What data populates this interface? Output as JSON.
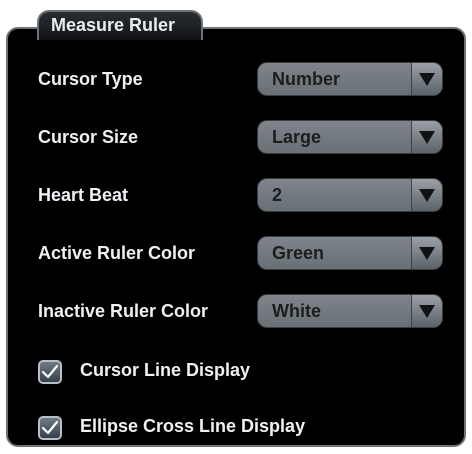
{
  "panel": {
    "title": "Measure Ruler"
  },
  "fields": [
    {
      "label": "Cursor Type",
      "value": "Number"
    },
    {
      "label": "Cursor Size",
      "value": "Large"
    },
    {
      "label": "Heart Beat",
      "value": "2"
    },
    {
      "label": "Active Ruler Color",
      "value": "Green"
    },
    {
      "label": "Inactive Ruler Color",
      "value": "White"
    }
  ],
  "checkboxes": [
    {
      "label": "Cursor Line Display",
      "checked": true
    },
    {
      "label": "Ellipse Cross Line Display",
      "checked": true
    }
  ],
  "icons": {
    "dropdown": "chevron-down-icon",
    "check": "checkmark-icon"
  }
}
